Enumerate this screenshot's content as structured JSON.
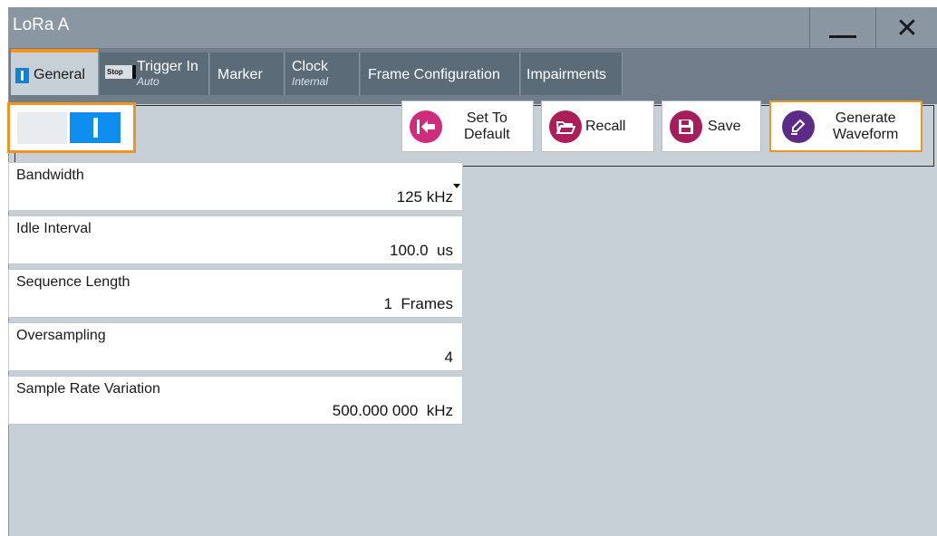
{
  "window": {
    "title": "LoRa A"
  },
  "window_controls": {
    "minimize_icon": "minimize-icon",
    "close_symbol": "✕"
  },
  "tabs": [
    {
      "label": "General",
      "icon": "blue-square-icon"
    },
    {
      "label": "Trigger In",
      "sub": "Auto",
      "badge": "Stop"
    },
    {
      "label": "Marker"
    },
    {
      "label": "Clock",
      "sub": "Internal"
    },
    {
      "label": "Frame Configuration"
    },
    {
      "label": "Impairments"
    }
  ],
  "toolbar": {
    "state_toggle": {
      "state": "on",
      "icon": "power-on-icon"
    },
    "set_default": {
      "line1": "Set To",
      "line2": "Default",
      "icon": "arrow-left-icon",
      "color": "#cf2c7e"
    },
    "recall": {
      "label": "Recall",
      "icon": "folder-icon",
      "color": "#ad1e58"
    },
    "save": {
      "label": "Save",
      "icon": "floppy-icon",
      "color": "#a61d5c"
    },
    "generate": {
      "line1": "Generate",
      "line2": "Waveform",
      "icon": "pen-icon",
      "color": "#5c2a87"
    }
  },
  "fields": [
    {
      "label": "Bandwidth",
      "value": "125 kHz",
      "type": "dropdown"
    },
    {
      "label": "Idle Interval",
      "value": "100.0  us"
    },
    {
      "label": "Sequence Length",
      "value": "1  Frames"
    },
    {
      "label": "Oversampling",
      "value": "4"
    },
    {
      "label": "Sample Rate Variation",
      "value": "500.000 000  kHz"
    }
  ],
  "colors": {
    "accent": "#f3941e",
    "toggle_on": "#0f8ef0",
    "background": "#c7d0d6",
    "tabbar": "#6f7e8a"
  }
}
